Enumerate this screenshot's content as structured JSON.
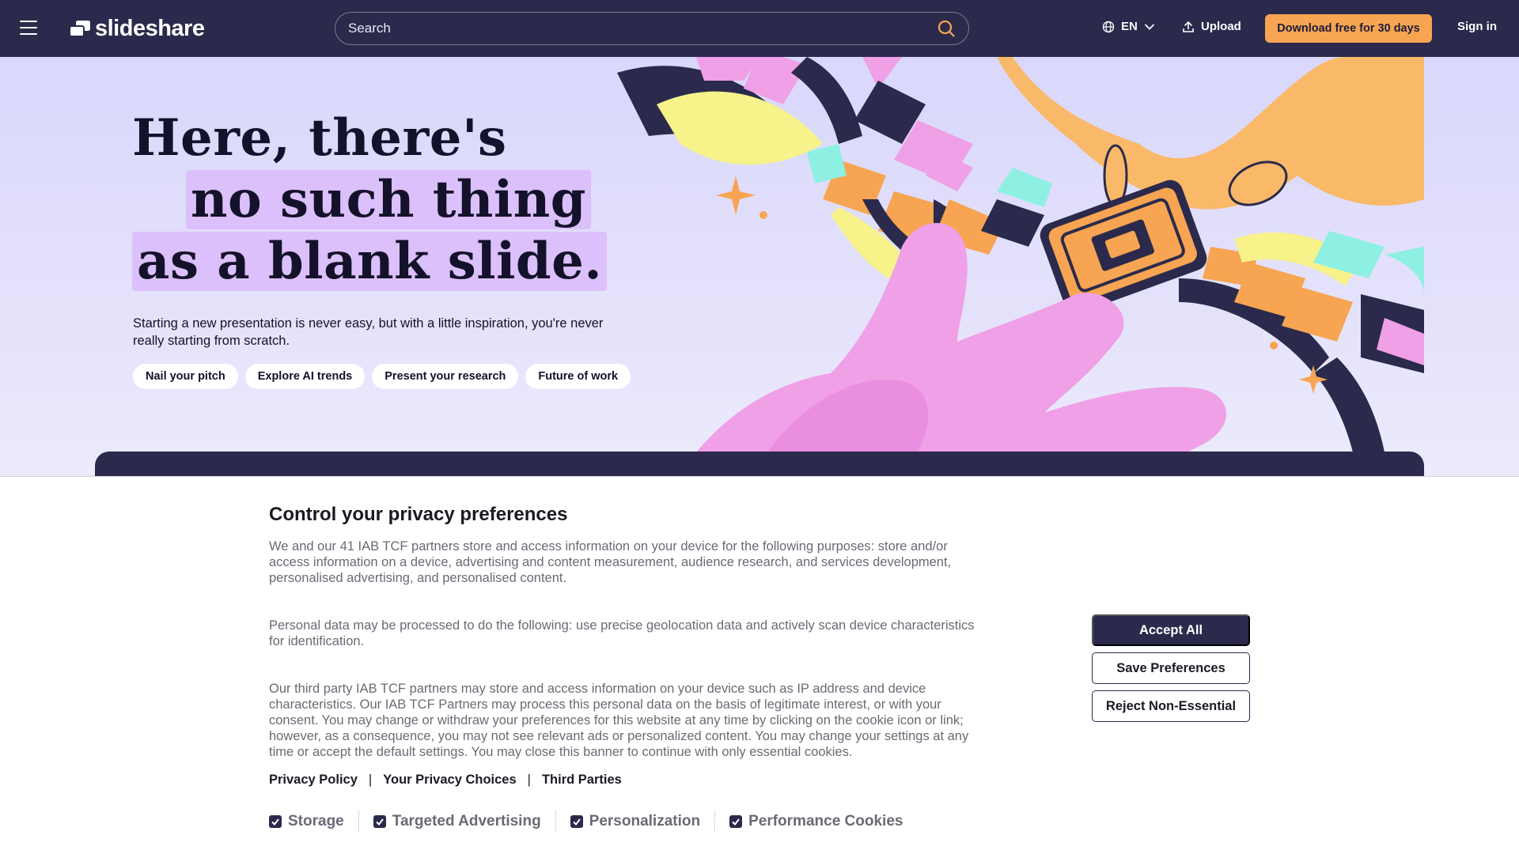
{
  "nav": {
    "brand": "slideshare",
    "search_placeholder": "Search",
    "language": "EN",
    "upload_label": "Upload",
    "download_label": "Download free for 30 days",
    "signin_label": "Sign in"
  },
  "hero": {
    "headline_line1": "Here, there's",
    "headline_line2": "no such thing",
    "headline_line3": "as a blank slide.",
    "subtext": "Starting a new presentation is never easy, but with a little inspiration, you're never really starting from scratch.",
    "chips": [
      "Nail your pitch",
      "Explore AI trends",
      "Present your research",
      "Future of work"
    ]
  },
  "privacy": {
    "title": "Control your privacy preferences",
    "paragraph1": "We and our 41 IAB TCF partners store and access information on your device for the following purposes: store and/or access information on a device, advertising and content measurement, audience research, and services development, personalised advertising, and personalised content.",
    "paragraph2": "Personal data may be processed to do the following: use precise geolocation data and actively scan device characteristics for identification.",
    "paragraph3": "Our third party IAB TCF partners may store and access information on your device such as IP address and device characteristics. Our IAB TCF Partners may process this personal data on the basis of legitimate interest, or with your consent. You may change or withdraw your preferences for this website at any time by clicking on the cookie icon or link; however, as a consequence, you may not see relevant ads or personalized content. You may change your settings at any time or accept the default settings. You may close this banner to continue with only essential cookies.",
    "links": [
      "Privacy Policy",
      "Your Privacy Choices",
      "Third Parties"
    ],
    "link_separator": "|",
    "checkboxes": [
      "Storage",
      "Targeted Advertising",
      "Personalization",
      "Performance Cookies"
    ],
    "accept_label": "Accept All",
    "save_label": "Save Preferences",
    "reject_label": "Reject Non-Essential"
  },
  "colors": {
    "navy": "#2b2a4c",
    "orange": "#f7a552",
    "lavender": "#d9d7fb",
    "highlight": "#dcc0fb",
    "pink": "#f0a0e6"
  }
}
